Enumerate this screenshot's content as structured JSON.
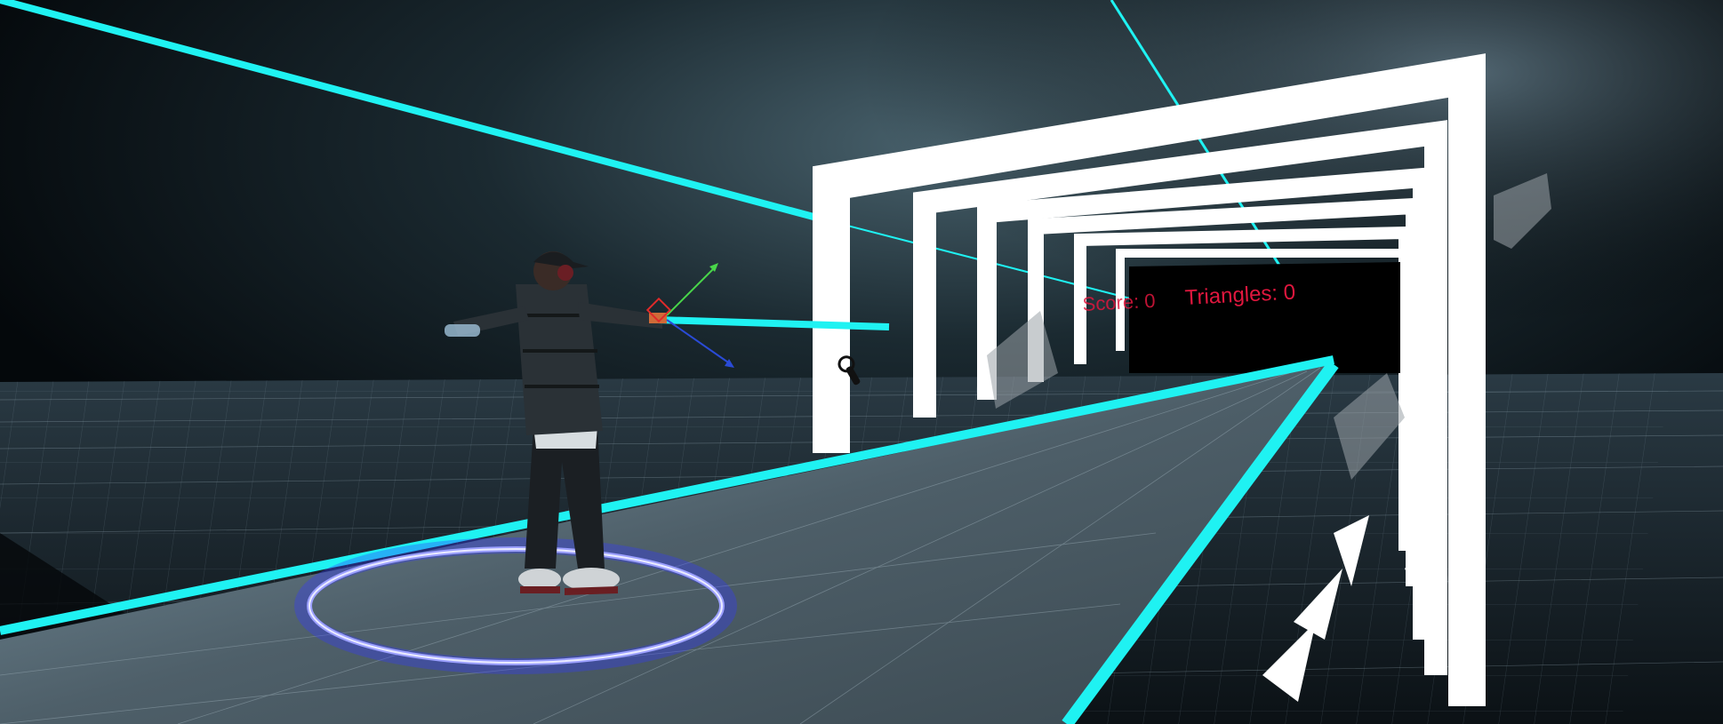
{
  "hud": {
    "score_label": "Score: 0",
    "triangles_label": "Triangles: 0",
    "text_color": "#e0173e"
  },
  "scene": {
    "background_color": "#05090c",
    "neon_color": "#1ff2f2",
    "tunnel_color": "#ffffff",
    "ring_color": "#6f73ff",
    "floor_color": "#3b4a55"
  },
  "icons": {
    "cursor": "controller-cursor-icon",
    "gizmo": "transform-gizmo-icon",
    "ring": "spawn-ring-icon"
  }
}
